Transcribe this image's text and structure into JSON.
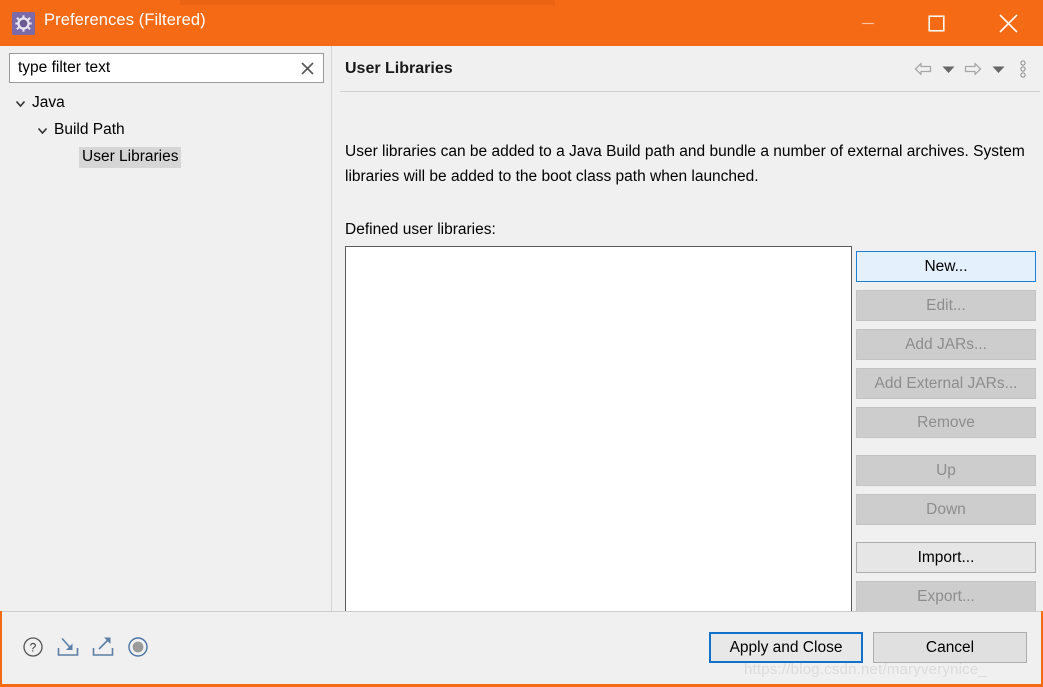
{
  "window": {
    "title": "Preferences (Filtered)",
    "icon": "gear-icon",
    "minimize_label": "—",
    "maximize_label": "□",
    "close_label": "✕",
    "accent_color": "#f56a14"
  },
  "sidebar": {
    "filter": {
      "value": "type filter text",
      "placeholder": "type filter text",
      "clear_label": "✕"
    },
    "tree": [
      {
        "label": "Java",
        "depth": 0,
        "expanded": true,
        "selected": false
      },
      {
        "label": "Build Path",
        "depth": 1,
        "expanded": true,
        "selected": false
      },
      {
        "label": "User Libraries",
        "depth": 2,
        "expanded": false,
        "selected": true
      }
    ]
  },
  "page": {
    "title": "User Libraries",
    "description": "User libraries can be added to a Java Build path and bundle a number of external archives. System libraries will be added to the boot class path when launched.",
    "list_label": "Defined user libraries:",
    "list_items": [],
    "toolbar": [
      {
        "name": "back-icon",
        "label": "⇐"
      },
      {
        "name": "back-dropdown-icon",
        "label": "▾"
      },
      {
        "name": "forward-icon",
        "label": "⇒"
      },
      {
        "name": "forward-dropdown-icon",
        "label": "▾"
      },
      {
        "name": "view-menu-icon",
        "label": "⋮"
      }
    ],
    "buttons": [
      {
        "label": "New...",
        "state": "focused"
      },
      {
        "label": "Edit...",
        "state": "disabled"
      },
      {
        "label": "Add JARs...",
        "state": "disabled"
      },
      {
        "label": "Add External JARs...",
        "state": "disabled"
      },
      {
        "label": "Remove",
        "state": "disabled"
      },
      {
        "label": "Up",
        "state": "disabled"
      },
      {
        "label": "Down",
        "state": "disabled"
      },
      {
        "label": "Import...",
        "state": "enabled"
      },
      {
        "label": "Export...",
        "state": "disabled"
      }
    ]
  },
  "footer": {
    "icons": [
      {
        "name": "help-icon",
        "label": "?"
      },
      {
        "name": "import-preferences-icon",
        "label": "import"
      },
      {
        "name": "export-preferences-icon",
        "label": "export"
      },
      {
        "name": "restore-defaults-icon",
        "label": "disc"
      }
    ],
    "apply_label": "Apply and Close",
    "cancel_label": "Cancel"
  },
  "watermark": "https://blog.csdn.net/maryverynice_"
}
